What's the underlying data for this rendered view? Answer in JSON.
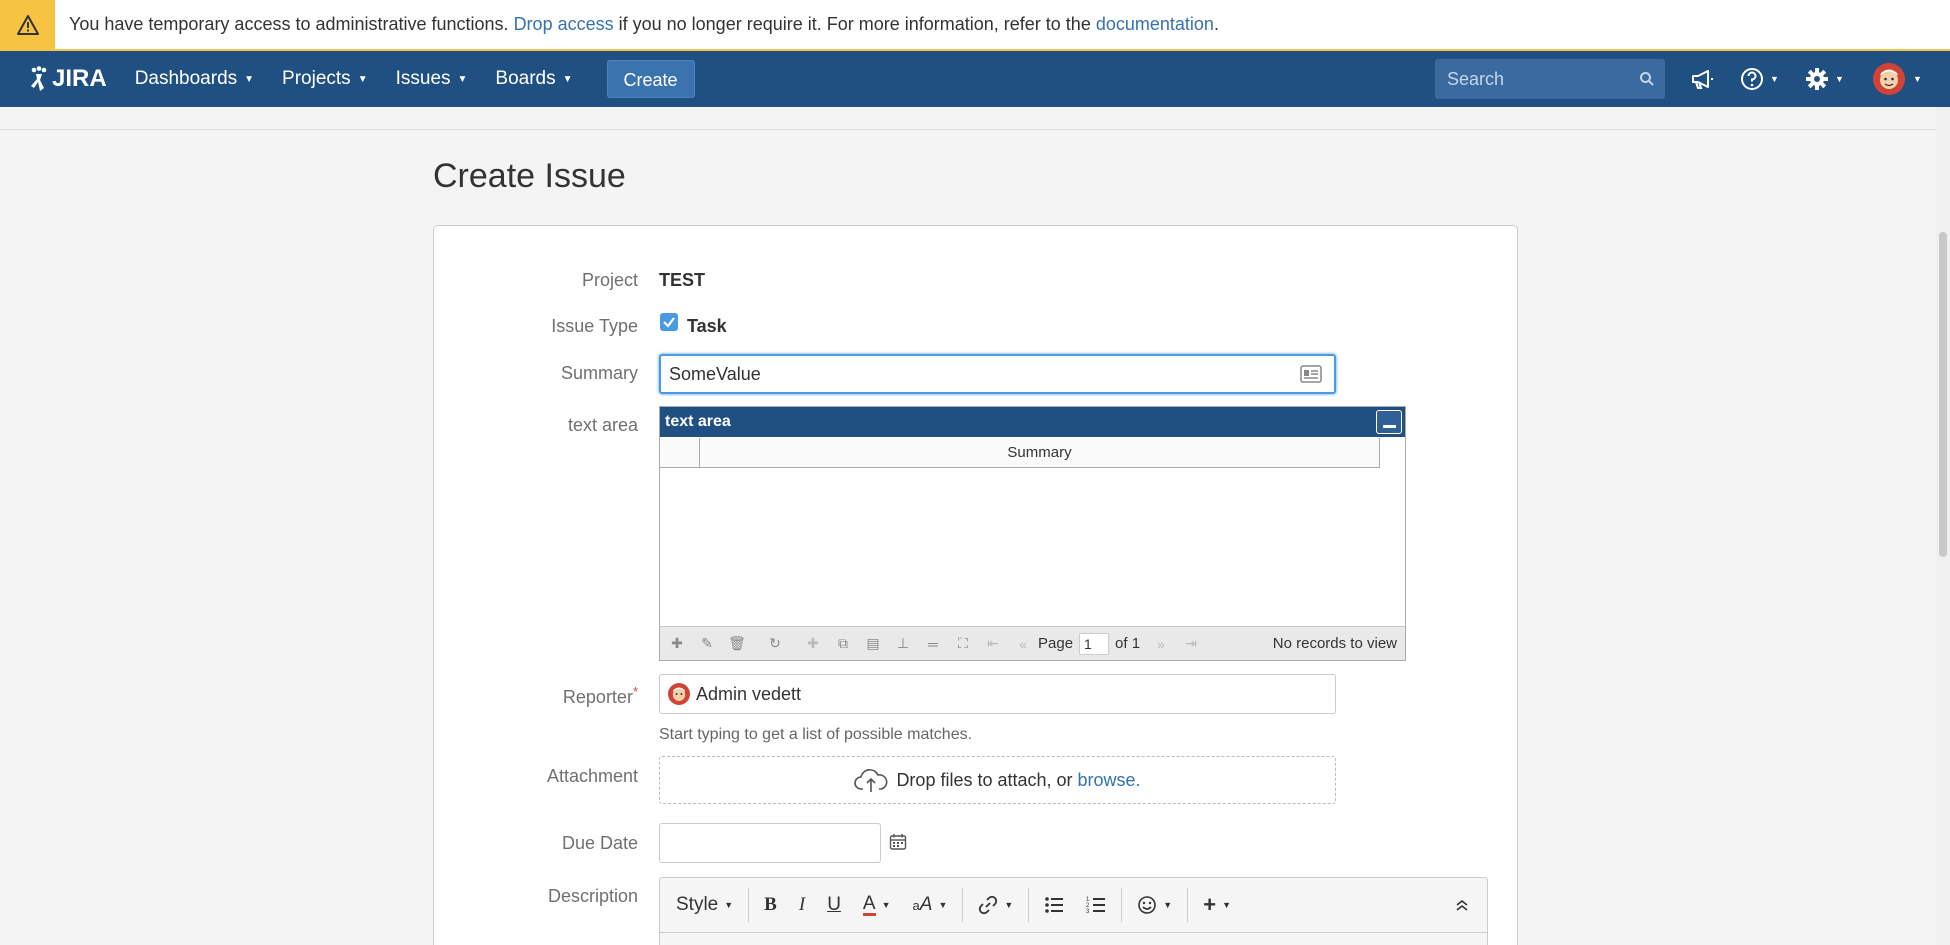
{
  "banner": {
    "text_before": "You have temporary access to administrative functions. ",
    "link_drop": "Drop access",
    "text_middle": " if you no longer require it. For more information, refer to the ",
    "link_docs": "documentation",
    "text_after": "."
  },
  "nav": {
    "logo": "JIRA",
    "items": [
      "Dashboards",
      "Projects",
      "Issues",
      "Boards"
    ],
    "create_label": "Create",
    "search_placeholder": "Search"
  },
  "page": {
    "title": "Create Issue"
  },
  "form": {
    "project_label": "Project",
    "project_value": "TEST",
    "issue_type_label": "Issue Type",
    "issue_type_value": "Task",
    "summary_label": "Summary",
    "summary_value": "SomeValue",
    "textarea_label": "text area",
    "grid": {
      "title": "text area",
      "column": "Summary",
      "page_label": "Page",
      "page_value": "1",
      "of_label": "of 1",
      "empty": "No records to view"
    },
    "reporter_label": "Reporter",
    "reporter_required": "*",
    "reporter_value": "Admin vedett",
    "reporter_hint": "Start typing to get a list of possible matches.",
    "attachment_label": "Attachment",
    "attachment_text": "Drop files to attach, or",
    "attachment_link": "browse.",
    "due_date_label": "Due Date",
    "description_label": "Description",
    "editor": {
      "style_label": "Style"
    }
  },
  "colors": {
    "nav_bg": "#205081",
    "banner_accent": "#f6c342",
    "link": "#3572b0",
    "focus": "#4a9ae1"
  }
}
